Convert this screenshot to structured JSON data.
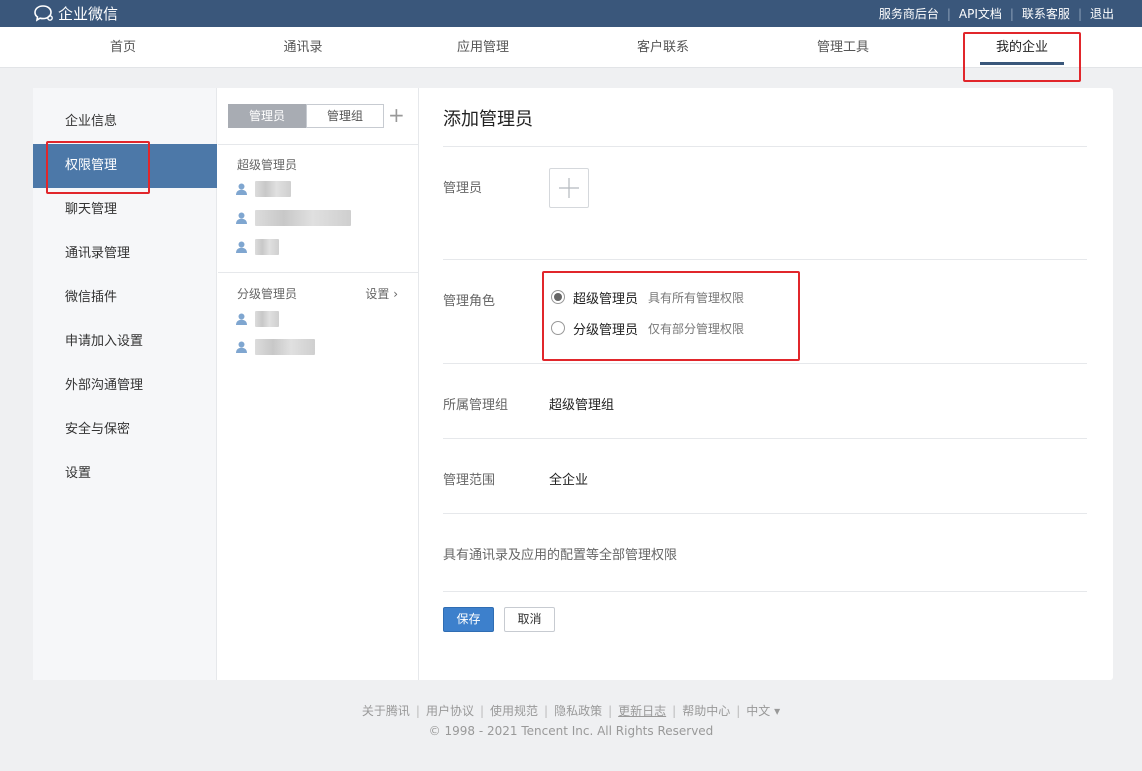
{
  "app": {
    "brand": "企业微信"
  },
  "toplinks": [
    {
      "label": "服务商后台"
    },
    {
      "label": "API文档"
    },
    {
      "label": "联系客服"
    },
    {
      "label": "退出"
    }
  ],
  "nav": [
    {
      "label": "首页"
    },
    {
      "label": "通讯录"
    },
    {
      "label": "应用管理"
    },
    {
      "label": "客户联系"
    },
    {
      "label": "管理工具"
    },
    {
      "label": "我的企业",
      "active": true
    }
  ],
  "sidebar": {
    "items": [
      {
        "label": "企业信息"
      },
      {
        "label": "权限管理",
        "active": true
      },
      {
        "label": "聊天管理"
      },
      {
        "label": "通讯录管理"
      },
      {
        "label": "微信插件"
      },
      {
        "label": "申请加入设置"
      },
      {
        "label": "外部沟通管理"
      },
      {
        "label": "安全与保密"
      },
      {
        "label": "设置"
      }
    ]
  },
  "middle": {
    "tabs": [
      {
        "label": "管理员",
        "active": true
      },
      {
        "label": "管理组"
      }
    ],
    "plus_icon": "plus-icon",
    "super_section_label": "超级管理员",
    "sub_section_label": "分级管理员",
    "sub_setting_label": "设置 ›"
  },
  "content": {
    "title": "添加管理员",
    "admin_label": "管理员",
    "role_label": "管理角色",
    "roles": [
      {
        "label": "超级管理员",
        "desc": "具有所有管理权限",
        "checked": true
      },
      {
        "label": "分级管理员",
        "desc": "仅有部分管理权限",
        "checked": false
      }
    ],
    "group_label": "所属管理组",
    "group_value": "超级管理组",
    "scope_label": "管理范围",
    "scope_value": "全企业",
    "description": "具有通讯录及应用的配置等全部管理权限",
    "save_label": "保存",
    "cancel_label": "取消"
  },
  "footer": {
    "links": [
      {
        "label": "关于腾讯"
      },
      {
        "label": "用户协议"
      },
      {
        "label": "使用规范"
      },
      {
        "label": "隐私政策"
      },
      {
        "label": "更新日志"
      },
      {
        "label": "帮助中心"
      },
      {
        "label": "中文 ▾"
      }
    ],
    "copyright": "© 1998 - 2021 Tencent Inc. All Rights Reserved"
  },
  "colors": {
    "topbar": "#3a577b",
    "sidebar_active": "#4c78a8",
    "primary_button": "#3d80cc",
    "highlight": "#e1262b"
  }
}
